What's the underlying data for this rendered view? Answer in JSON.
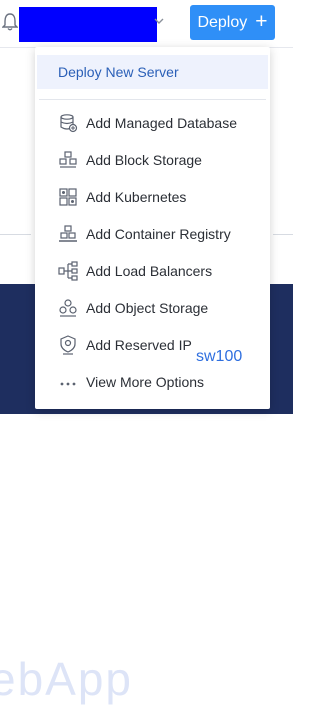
{
  "header": {
    "deploy_label": "Deploy",
    "deploy_plus": "+"
  },
  "menu": {
    "primary": "Deploy New Server",
    "items": [
      {
        "label": "Add Managed Database",
        "icon": "database-icon"
      },
      {
        "label": "Add Block Storage",
        "icon": "block-storage-icon"
      },
      {
        "label": "Add Kubernetes",
        "icon": "kubernetes-icon"
      },
      {
        "label": "Add Container Registry",
        "icon": "container-registry-icon"
      },
      {
        "label": "Add Load Balancers",
        "icon": "load-balancer-icon"
      },
      {
        "label": "Add Object Storage",
        "icon": "object-storage-icon"
      },
      {
        "label": "Add Reserved IP",
        "icon": "reserved-ip-icon"
      },
      {
        "label": "View More Options",
        "icon": "more-dots-icon"
      }
    ]
  },
  "overlay_text": "sw100",
  "background_text": "ebApp",
  "colors": {
    "accent": "#2f8ff7",
    "primary_text": "#2a5fb7",
    "dark_panel": "#1e2e5f",
    "redaction": "#0000ff"
  }
}
